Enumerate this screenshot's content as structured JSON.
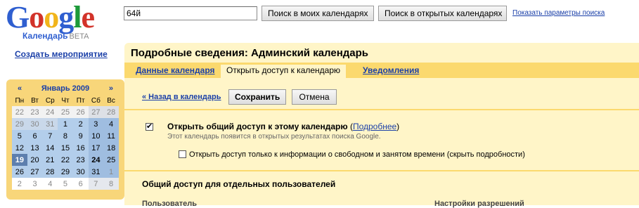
{
  "logo": {
    "letters": [
      "G",
      "o",
      "o",
      "g",
      "l",
      "e"
    ],
    "subtitle": "Календарь",
    "beta": "BETA"
  },
  "search": {
    "query": "64й",
    "button_mine": "Поиск в моих календарях",
    "button_public": "Поиск в открытых календарях",
    "options_link": "Показать параметры поиска"
  },
  "sidebar": {
    "create_event": "Создать мероприятие",
    "mini_calendar": {
      "prev": "«",
      "next": "»",
      "month": "Январь 2009",
      "weekdays": [
        "Пн",
        "Вт",
        "Ср",
        "Чт",
        "Пт",
        "Сб",
        "Вс"
      ],
      "weeks": [
        [
          "22",
          "23",
          "24",
          "25",
          "26",
          "27",
          "28"
        ],
        [
          "29",
          "30",
          "31",
          "1",
          "2",
          "3",
          "4"
        ],
        [
          "5",
          "6",
          "7",
          "8",
          "9",
          "10",
          "11"
        ],
        [
          "12",
          "13",
          "14",
          "15",
          "16",
          "17",
          "18"
        ],
        [
          "19",
          "20",
          "21",
          "22",
          "23",
          "24",
          "25"
        ],
        [
          "26",
          "27",
          "28",
          "29",
          "30",
          "31",
          "1"
        ],
        [
          "2",
          "3",
          "4",
          "5",
          "6",
          "7",
          "8"
        ]
      ]
    }
  },
  "main": {
    "title": "Подробные сведения: Админский календарь",
    "tabs": [
      {
        "label": "Данные календаря"
      },
      {
        "label": "Открыть доступ к календарю"
      },
      {
        "label": "Уведомления"
      }
    ],
    "back_link": "« Назад в календарь",
    "save": "Сохранить",
    "cancel": "Отмена",
    "share_public": {
      "label": "Открыть общий доступ к этому календарю",
      "more_open": "(",
      "more_link": "Подробнее",
      "more_close": ")",
      "description": "Этот календарь появится в открытых результатах поиска Google.",
      "checked_mark": "✔"
    },
    "busy_only": "Открыть доступ только к информации о свободном и занятом времени (скрыть подробности)",
    "individual": {
      "title": "Общий доступ для отдельных пользователей",
      "col_user": "Пользователь",
      "col_permissions": "Настройки разрешений"
    }
  }
}
